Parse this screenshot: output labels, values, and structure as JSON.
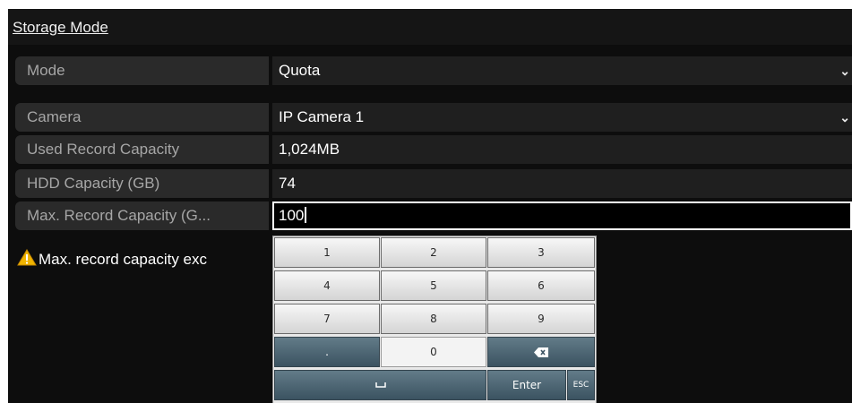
{
  "panel": {
    "title": "Storage Mode"
  },
  "fields": {
    "mode": {
      "label": "Mode",
      "value": "Quota"
    },
    "camera": {
      "label": "Camera",
      "value": "IP Camera 1"
    },
    "used_capacity": {
      "label": "Used Record Capacity",
      "value": "1,024MB"
    },
    "hdd_capacity": {
      "label": "HDD Capacity (GB)",
      "value": "74"
    },
    "max_capacity": {
      "label": "Max. Record Capacity (G...",
      "value": "100"
    }
  },
  "warning": {
    "text": "Max. record capacity exc",
    "icon": "warning-triangle-icon"
  },
  "keypad": {
    "keys": {
      "k1": "1",
      "k2": "2",
      "k3": "3",
      "k4": "4",
      "k5": "5",
      "k6": "6",
      "k7": "7",
      "k8": "8",
      "k9": "9",
      "dot": ".",
      "k0": "0",
      "enter": "Enter",
      "esc": "ESC"
    },
    "icons": {
      "backspace": "backspace-icon",
      "space": "space-bar-icon"
    }
  },
  "colors": {
    "background": "#0d0d0d",
    "label_bg": "#2a2a2a",
    "value_bg": "#1f1f1f",
    "key_dark": "#4a6270",
    "warning": "#f0b400"
  }
}
